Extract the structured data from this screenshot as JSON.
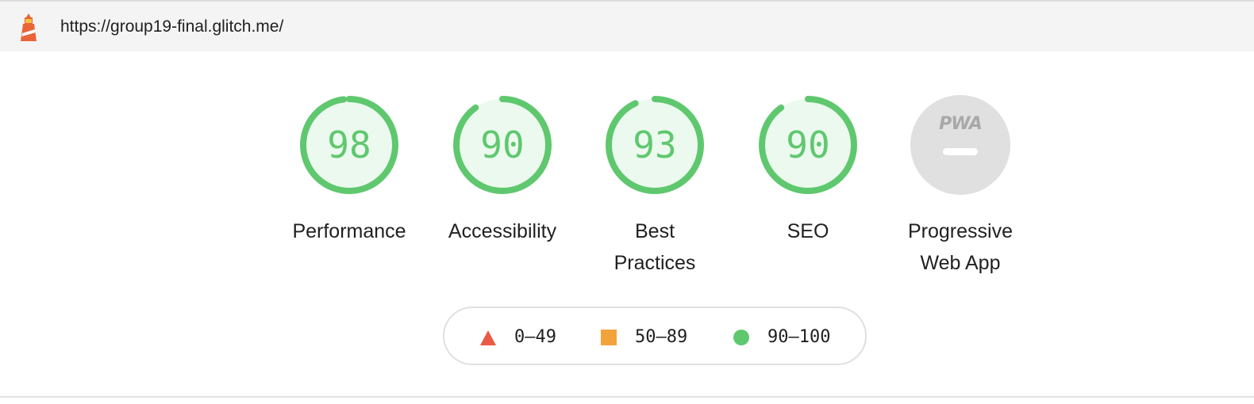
{
  "header": {
    "url": "https://group19-final.glitch.me/",
    "logo_icon": "lighthouse-icon"
  },
  "gauges": [
    {
      "label": "Performance",
      "score": "98",
      "value": 98
    },
    {
      "label": "Accessibility",
      "score": "90",
      "value": 90
    },
    {
      "label": "Best Practices",
      "score": "93",
      "value": 93
    },
    {
      "label": "SEO",
      "score": "90",
      "value": 90
    },
    {
      "label": "Progressive Web App",
      "badge": "PWA",
      "icon": "pwa-icon"
    }
  ],
  "legend": [
    {
      "range": "0–49",
      "shape": "triangle",
      "color": "#eb5a46"
    },
    {
      "range": "50–89",
      "shape": "square",
      "color": "#f3a33c"
    },
    {
      "range": "90–100",
      "shape": "circle",
      "color": "#5fc86f"
    }
  ],
  "colors": {
    "pass": "#5fc86f",
    "pass_fill": "#ecf9ee",
    "na_fill": "#e0e0e0",
    "na_mark": "#ffffff"
  }
}
